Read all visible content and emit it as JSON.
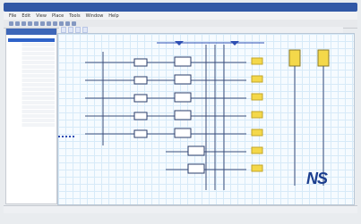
{
  "window": {
    "title": ""
  },
  "menu": [
    "File",
    "Edit",
    "View",
    "Place",
    "Tools",
    "Window",
    "Help"
  ],
  "tabs": [
    "",
    "",
    "",
    ""
  ],
  "left_panel": {
    "title": "",
    "items": [
      "",
      "",
      "",
      "",
      "",
      "",
      "",
      "",
      "",
      "",
      "",
      "",
      "",
      "",
      "",
      "",
      "",
      "",
      "",
      ""
    ]
  },
  "canvas": {
    "annotation": "",
    "logo": {
      "mark": "NS",
      "subtext": ""
    }
  },
  "status": {
    "left": "",
    "right": ""
  },
  "colors": {
    "title_bar": "#3158a6",
    "accent": "#2f63c9",
    "grid": "#d7eaf8",
    "connector": "#f4d84a",
    "annotation": "#e24b4b",
    "logo": "#1b3e8f"
  },
  "icons": [
    "new-icon",
    "open-icon",
    "save-icon",
    "print-icon",
    "cut-icon",
    "copy-icon",
    "paste-icon",
    "undo-icon",
    "redo-icon",
    "zoom-in-icon",
    "zoom-out-icon",
    "net-flag-icon"
  ]
}
